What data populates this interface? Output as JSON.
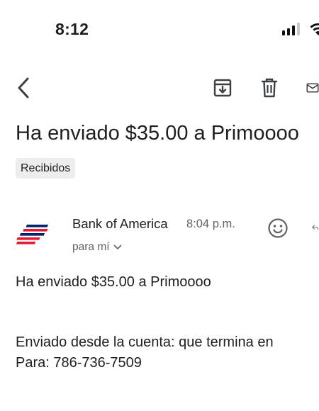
{
  "status_bar": {
    "time": "8:12"
  },
  "toolbar": {
    "back_icon": "arrow-back-icon",
    "archive_icon": "archive-icon",
    "delete_icon": "trash-icon",
    "mail_icon": "mail-icon"
  },
  "email": {
    "subject": "Ha enviado $35.00 a Primoooo",
    "label": "Recibidos",
    "sender": "Bank of America",
    "time": "8:04 p.m.",
    "recipient": "para mí",
    "body": {
      "line1": "Ha enviado $35.00 a Primoooo",
      "line2": "Enviado desde la cuenta: que termina en",
      "line3": "Para: 786-736-7509"
    }
  },
  "colors": {
    "brand_red": "#e31837",
    "brand_blue": "#012169",
    "icon_gray": "#5f6368"
  }
}
